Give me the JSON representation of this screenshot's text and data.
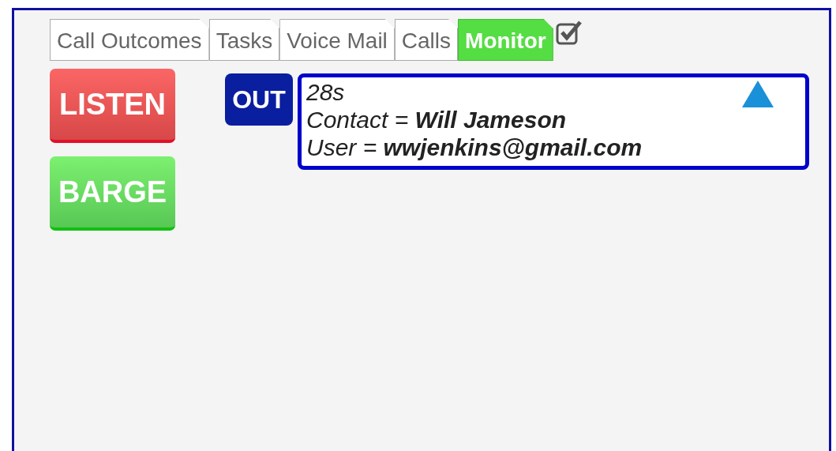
{
  "tabs": [
    {
      "label": "Call Outcomes",
      "selected": false
    },
    {
      "label": "Tasks",
      "selected": false
    },
    {
      "label": "Voice Mail",
      "selected": false
    },
    {
      "label": "Calls",
      "selected": false
    },
    {
      "label": "Monitor",
      "selected": true
    }
  ],
  "tab_checkbox": {
    "checked": true
  },
  "actions": [
    {
      "label": "LISTEN",
      "kind": "listen"
    },
    {
      "label": "BARGE",
      "kind": "barge"
    }
  ],
  "call": {
    "direction": "OUT",
    "lines": [
      "28s",
      "Contact = **Will Jameson**",
      "User = **wwjenkins@gmail.com**"
    ],
    "expanded": true
  }
}
